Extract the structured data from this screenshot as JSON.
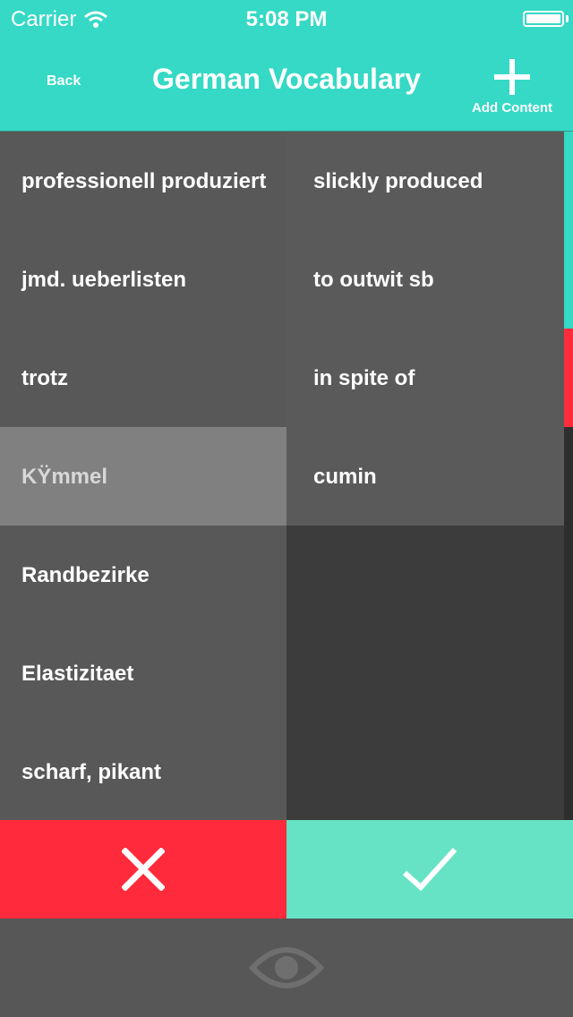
{
  "status_bar": {
    "carrier": "Carrier",
    "time": "5:08 PM"
  },
  "nav": {
    "back_label": "Back",
    "title": "German Vocabulary",
    "add_label": "Add Content"
  },
  "colors": {
    "header": "#35d9c5",
    "wrong": "#ff2a3b",
    "correct": "#66e3c4",
    "selected": "#808080"
  },
  "left_column": [
    {
      "text": "professionell produziert",
      "selected": false
    },
    {
      "text": "jmd. ueberlisten",
      "selected": false
    },
    {
      "text": "trotz",
      "selected": false
    },
    {
      "text": "KŸmmel",
      "selected": true
    },
    {
      "text": "Randbezirke",
      "selected": false
    },
    {
      "text": "Elastizitaet",
      "selected": false
    },
    {
      "text": "scharf, pikant",
      "selected": false
    }
  ],
  "right_column": [
    {
      "text": "slickly produced"
    },
    {
      "text": "to outwit sb"
    },
    {
      "text": "in spite of"
    },
    {
      "text": "cumin"
    }
  ],
  "actions": {
    "wrong_icon": "x-icon",
    "correct_icon": "checkmark-icon",
    "reveal_icon": "eye-icon"
  }
}
